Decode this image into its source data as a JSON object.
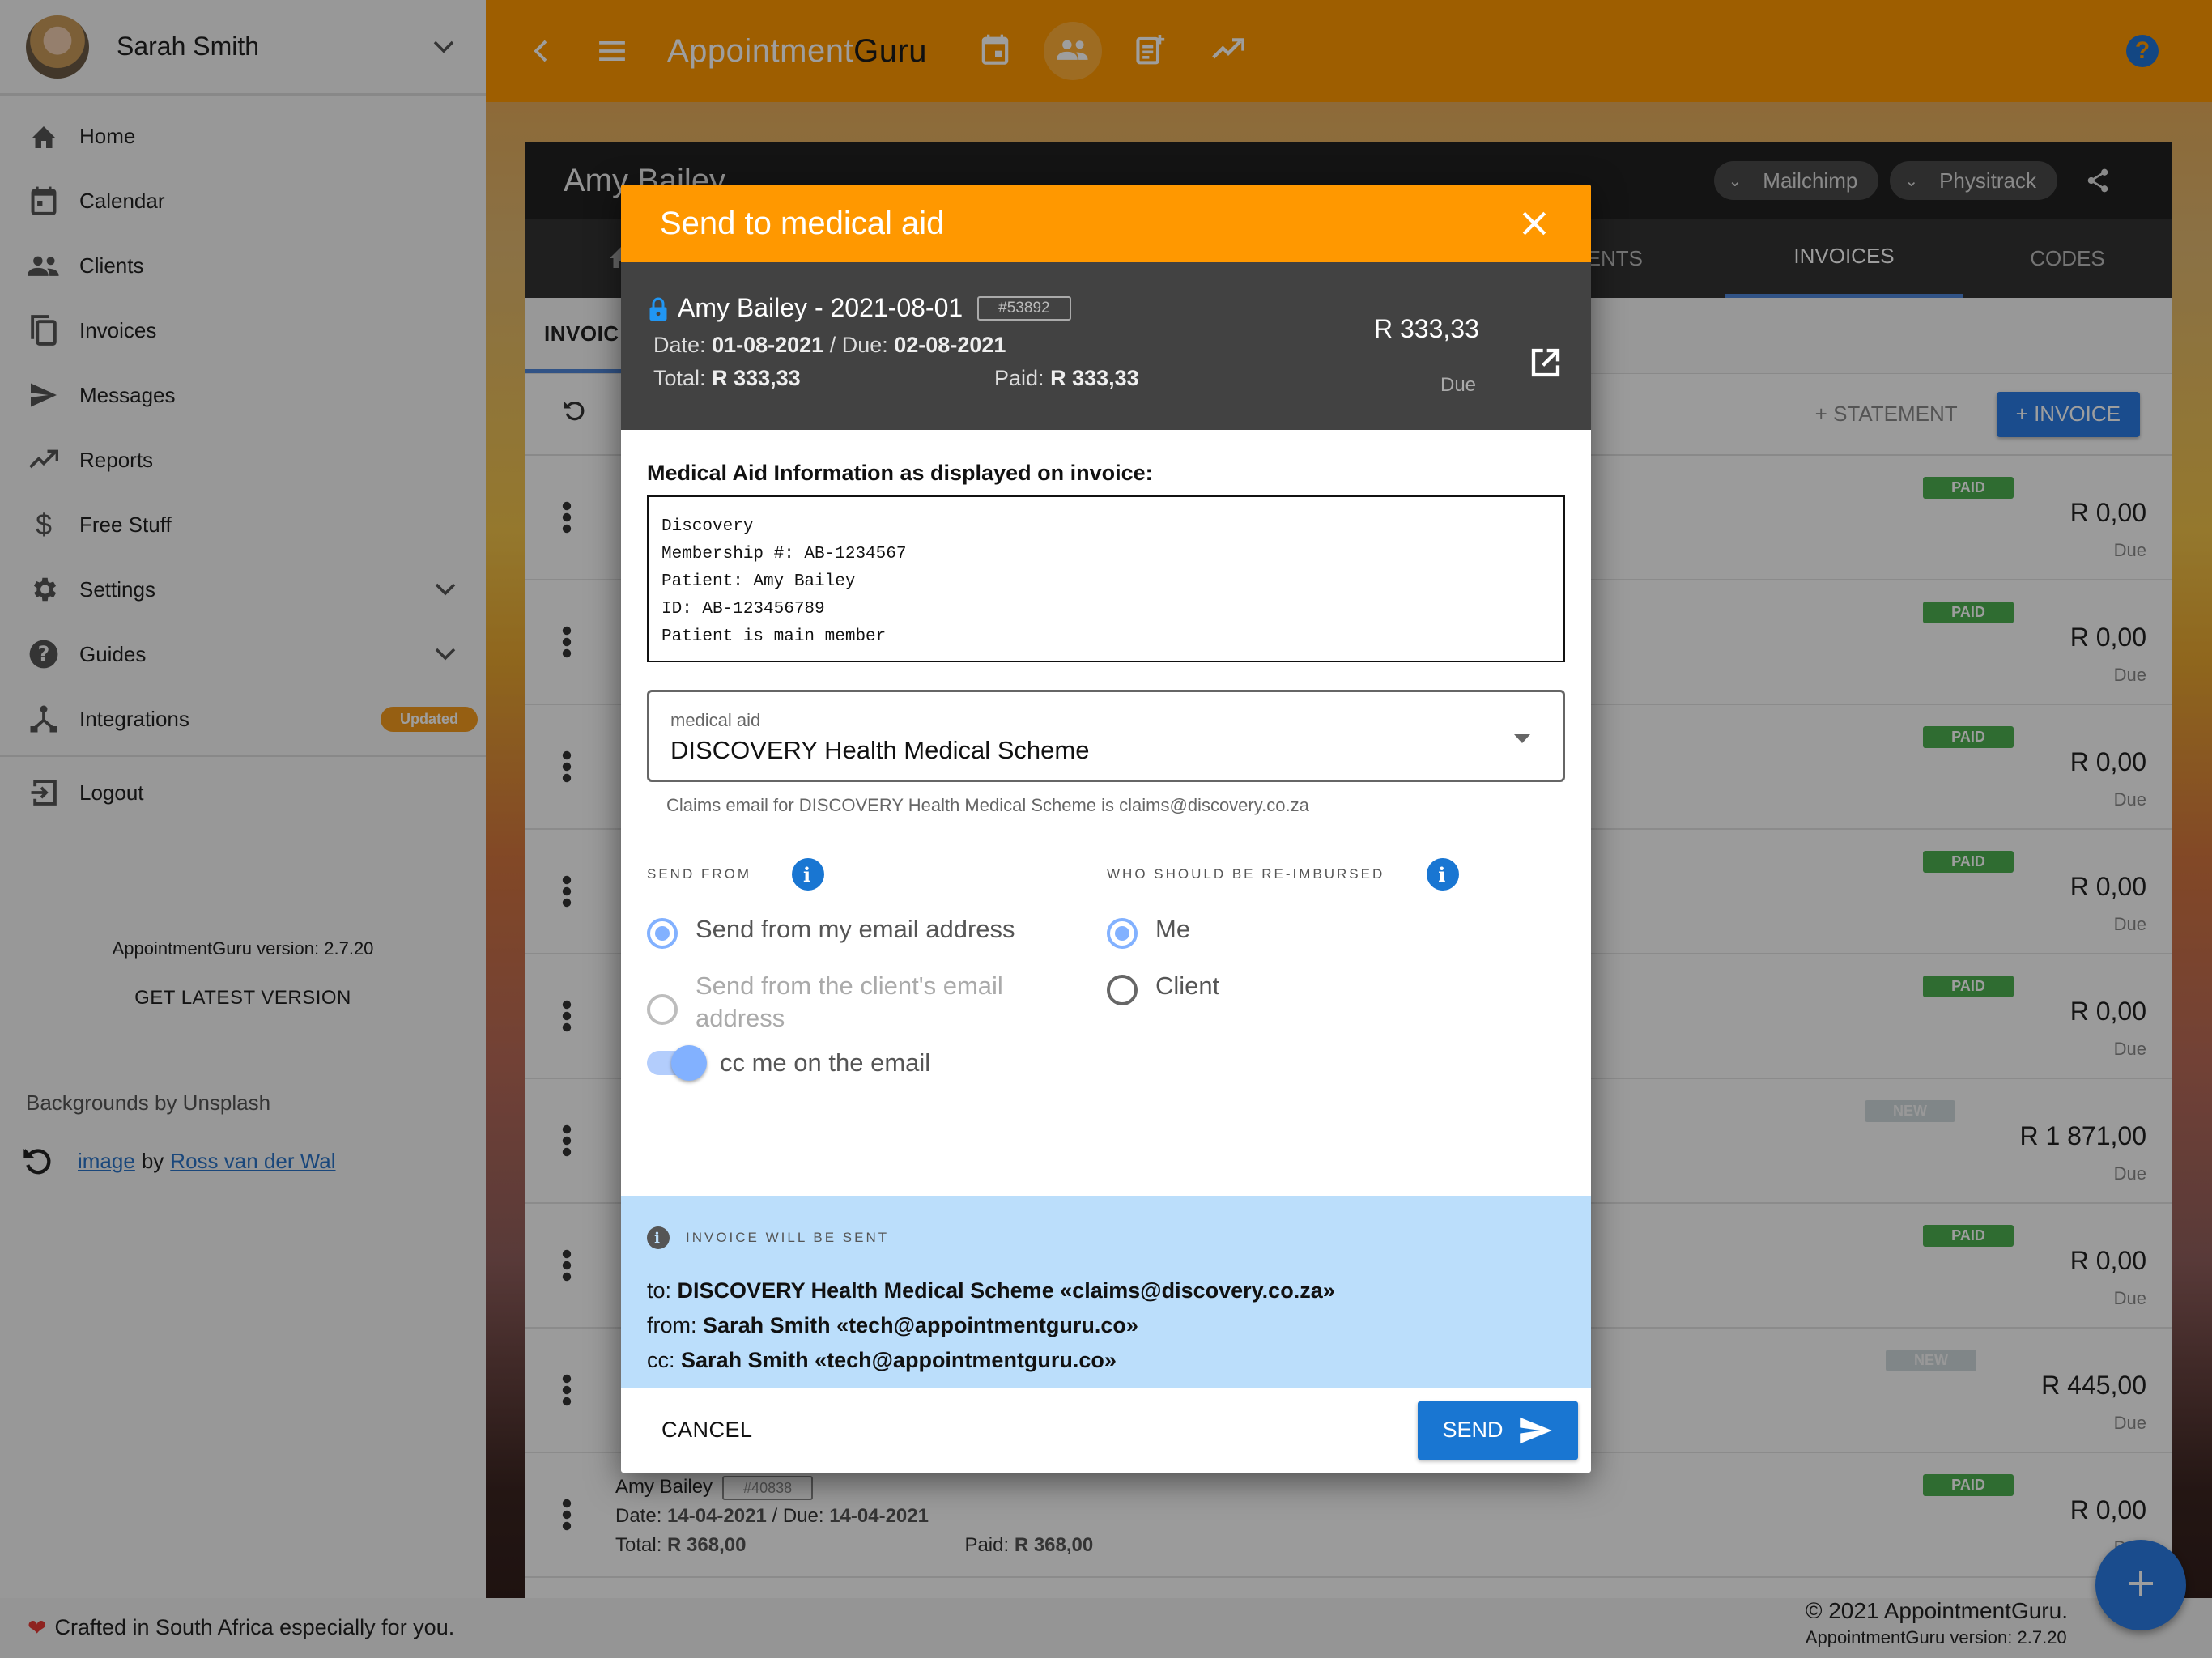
{
  "sidebar": {
    "user_name": "Sarah Smith",
    "items": [
      {
        "label": "Home",
        "icon": "home-icon"
      },
      {
        "label": "Calendar",
        "icon": "calendar-icon"
      },
      {
        "label": "Clients",
        "icon": "people-icon"
      },
      {
        "label": "Invoices",
        "icon": "copy-icon"
      },
      {
        "label": "Messages",
        "icon": "send-icon"
      },
      {
        "label": "Reports",
        "icon": "trending-up-icon"
      },
      {
        "label": "Free Stuff",
        "icon": "dollar-icon"
      },
      {
        "label": "Settings",
        "icon": "gear-icon",
        "expandable": true
      },
      {
        "label": "Guides",
        "icon": "help-circle-icon",
        "expandable": true
      },
      {
        "label": "Integrations",
        "icon": "integrations-icon",
        "badge": "Updated"
      }
    ],
    "logout_label": "Logout",
    "version_text": "AppointmentGuru version: 2.7.20",
    "get_latest_label": "GET LATEST VERSION",
    "backgrounds_label": "Backgrounds by Unsplash",
    "credit": {
      "image_link": "image",
      "by": "by",
      "author_link": "Ross van der Wal"
    }
  },
  "topbar": {
    "brand_part1": "Appointment",
    "brand_part2": "Guru",
    "help_label": "?"
  },
  "panel": {
    "client_name": "Amy Bailey",
    "chips": [
      "Mailchimp",
      "Physitrack"
    ],
    "tabs": [
      "MENTS",
      "INVOICES",
      "CODES"
    ],
    "active_tab": "INVOICES",
    "subtab": "INVOIC",
    "statement_label": "+ STATEMENT",
    "invoice_label": "+ INVOICE",
    "rows": [
      {
        "status": "PAID",
        "amount": "R 0,00",
        "due": "Due"
      },
      {
        "status": "PAID",
        "amount": "R 0,00",
        "due": "Due"
      },
      {
        "status": "PAID",
        "amount": "R 0,00",
        "due": "Due"
      },
      {
        "status": "PAID",
        "amount": "R 0,00",
        "due": "Due"
      },
      {
        "status": "PAID",
        "amount": "R 0,00",
        "due": "Due"
      },
      {
        "status": "NEW",
        "amount": "R 1 871,00",
        "due": "Due"
      },
      {
        "status": "PAID",
        "amount": "R 0,00",
        "due": "Due"
      },
      {
        "status": "NEW",
        "amount": "R 445,00",
        "due": "Due"
      },
      {
        "status": "PAID",
        "amount": "R 0,00",
        "due": "Due",
        "name": "Amy Bailey",
        "number": "#40838",
        "date_label": "Date:",
        "date": "14-04-2021",
        "due_label": "/ Due:",
        "due_date": "14-04-2021",
        "total_label": "Total:",
        "total": "R 368,00",
        "paid_label": "Paid:",
        "paid": "R 368,00"
      }
    ]
  },
  "footer": {
    "crafted": "Crafted in South Africa especially for you.",
    "copyright": "© 2021 AppointmentGuru.",
    "version": "AppointmentGuru version: 2.7.20"
  },
  "modal": {
    "title": "Send to medical aid",
    "invoice": {
      "title": "Amy Bailey - 2021-08-01",
      "number": "#53892",
      "date_label": "Date:",
      "date": "01-08-2021",
      "due_label": "/ Due:",
      "due_date": "02-08-2021",
      "total_label": "Total:",
      "total": "R 333,33",
      "paid_label": "Paid:",
      "paid": "R 333,33",
      "amount": "R 333,33",
      "amount_label": "Due"
    },
    "medical_aid_info_label": "Medical Aid Information as displayed on invoice:",
    "medical_aid_info": "Discovery\nMembership #: AB-1234567\nPatient: Amy Bailey\nID: AB-123456789\nPatient is main member",
    "select": {
      "label": "medical aid",
      "value": "DISCOVERY Health Medical Scheme"
    },
    "claims_hint": "Claims email for DISCOVERY Health Medical Scheme is claims@discovery.co.za",
    "send_from": {
      "title": "SEND FROM",
      "options": [
        {
          "label": "Send from my email address",
          "selected": true
        },
        {
          "label": "Send from the client's email address",
          "selected": false,
          "disabled": true
        }
      ]
    },
    "reimburse": {
      "title": "WHO SHOULD BE RE-IMBURSED",
      "options": [
        {
          "label": "Me",
          "selected": true
        },
        {
          "label": "Client",
          "selected": false
        }
      ]
    },
    "cc_toggle": {
      "label": "cc me on the email",
      "on": true
    },
    "summary": {
      "title": "INVOICE WILL BE SENT",
      "to_label": "to:",
      "to": "DISCOVERY Health Medical Scheme «claims@discovery.co.za»",
      "from_label": "from:",
      "from": "Sarah Smith «tech@appointmentguru.co»",
      "cc_label": "cc:",
      "cc": "Sarah Smith «tech@appointmentguru.co»"
    },
    "cancel_label": "CANCEL",
    "send_label": "SEND"
  },
  "colors": {
    "brand_orange": "#ff9800",
    "primary_blue": "#1976d2",
    "paid_green": "#4caf50",
    "summary_bg": "#bbdefb"
  }
}
